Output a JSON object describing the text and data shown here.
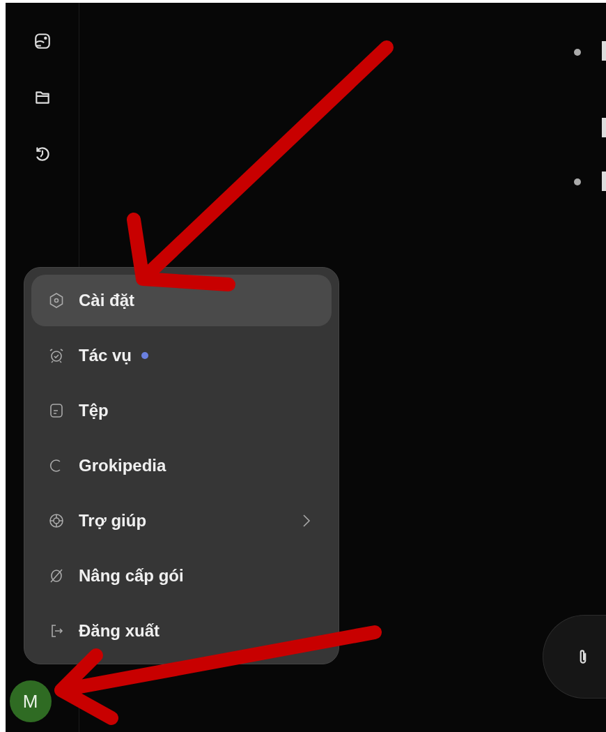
{
  "sidebar": {
    "avatar": {
      "initial": "M"
    }
  },
  "menu": {
    "items": [
      {
        "label": "Cài đặt",
        "selected": true,
        "notification": false,
        "submenu": false
      },
      {
        "label": "Tác vụ",
        "selected": false,
        "notification": true,
        "submenu": false
      },
      {
        "label": "Tệp",
        "selected": false,
        "notification": false,
        "submenu": false
      },
      {
        "label": "Grokipedia",
        "selected": false,
        "notification": false,
        "submenu": false
      },
      {
        "label": "Trợ giúp",
        "selected": false,
        "notification": false,
        "submenu": true
      },
      {
        "label": "Nâng cấp gói",
        "selected": false,
        "notification": false,
        "submenu": false
      },
      {
        "label": "Đăng xuất",
        "selected": false,
        "notification": false,
        "submenu": false
      }
    ]
  }
}
